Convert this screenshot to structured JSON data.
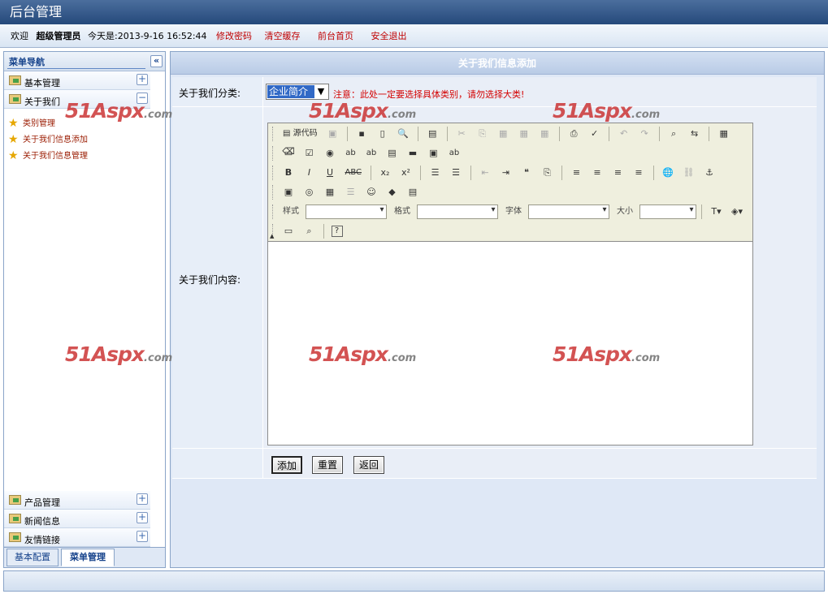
{
  "app_title": "后台管理",
  "header": {
    "welcome": "欢迎",
    "user": "超级管理员",
    "datetime": "今天是:2013-9-16 16:52:44",
    "links": [
      "修改密码",
      "清空缓存",
      "前台首页",
      "安全退出"
    ]
  },
  "sidebar": {
    "title": "菜单导航",
    "collapse_glyph": "«",
    "groups_top": [
      {
        "label": "基本管理",
        "toggle": "+"
      },
      {
        "label": "关于我们",
        "toggle": "−"
      }
    ],
    "items": [
      "类别管理",
      "关于我们信息添加",
      "关于我们信息管理"
    ],
    "groups_bottom": [
      {
        "label": "产品管理",
        "toggle": "+"
      },
      {
        "label": "新闻信息",
        "toggle": "+"
      },
      {
        "label": "友情链接",
        "toggle": "+"
      }
    ],
    "tabs": [
      "基本配置",
      "菜单管理"
    ]
  },
  "panel": {
    "title": "关于我们信息添加",
    "category_label": "关于我们分类:",
    "category_selected": "企业简介",
    "note": "注意：此处一定要选择具体类别，请勿选择大类!",
    "content_label": "关于我们内容:",
    "buttons": [
      "添加",
      "重置",
      "返回"
    ]
  },
  "editor": {
    "source_label": "源代码",
    "style_label": "样式",
    "format_label": "格式",
    "font_label": "字体",
    "size_label": "大小"
  },
  "watermark": {
    "text": "51Aspx",
    "suffix": ".com"
  }
}
